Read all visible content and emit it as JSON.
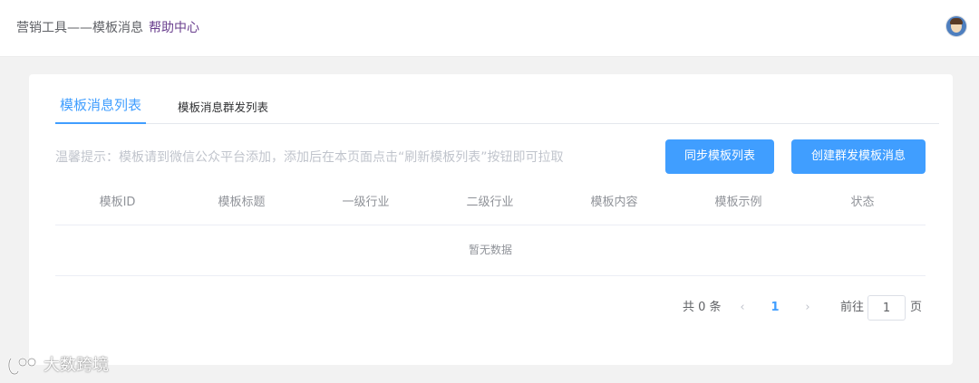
{
  "header": {
    "breadcrumb": "营销工具——模板消息",
    "help_link": "帮助中心"
  },
  "tabs": [
    {
      "label": "模板消息列表",
      "active": true
    },
    {
      "label": "模板消息群发列表",
      "active": false
    }
  ],
  "tip": "温馨提示：模板请到微信公众平台添加，添加后在本页面点击“刷新模板列表”按钮即可拉取",
  "buttons": {
    "sync": "同步模板列表",
    "create": "创建群发模板消息"
  },
  "table": {
    "columns": [
      "模板ID",
      "模板标题",
      "一级行业",
      "二级行业",
      "模板内容",
      "模板示例",
      "状态"
    ],
    "empty_text": "暂无数据"
  },
  "pagination": {
    "total": "共 0 条",
    "prev": "‹",
    "current_page": "1",
    "next": "›",
    "goto_label": "前往",
    "goto_value": "1",
    "page_unit": "页"
  },
  "watermark": "大数跨境",
  "colors": {
    "primary": "#409eff",
    "help_link": "#6a3f8e"
  }
}
